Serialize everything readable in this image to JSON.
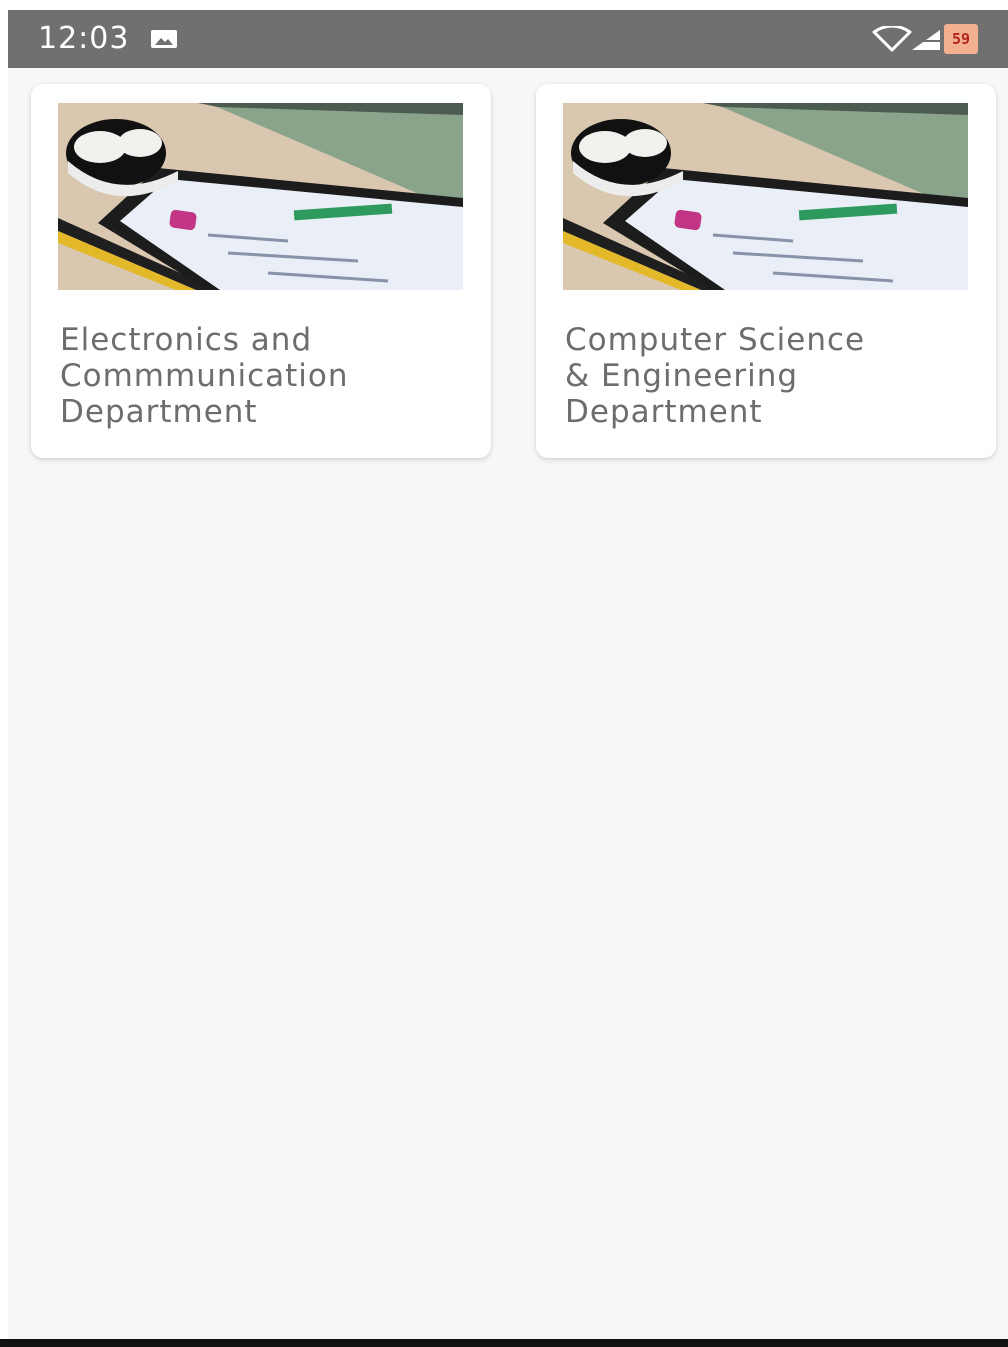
{
  "status_bar": {
    "time": "12:03",
    "battery_level": "59",
    "icons": [
      "image-notification-icon",
      "wifi-icon",
      "signal-icon",
      "battery-icon"
    ]
  },
  "cards": [
    {
      "title": "Electronics and\nCommmunication\nDepartment",
      "image": "phone-earbuds-photo"
    },
    {
      "title": "Computer Science\n& Engineering\nDepartment",
      "image": "phone-earbuds-photo"
    }
  ],
  "colors": {
    "status_bar": "#707070",
    "background": "#f8f8f8",
    "card": "#ffffff",
    "title_text": "#6d6d6d"
  }
}
